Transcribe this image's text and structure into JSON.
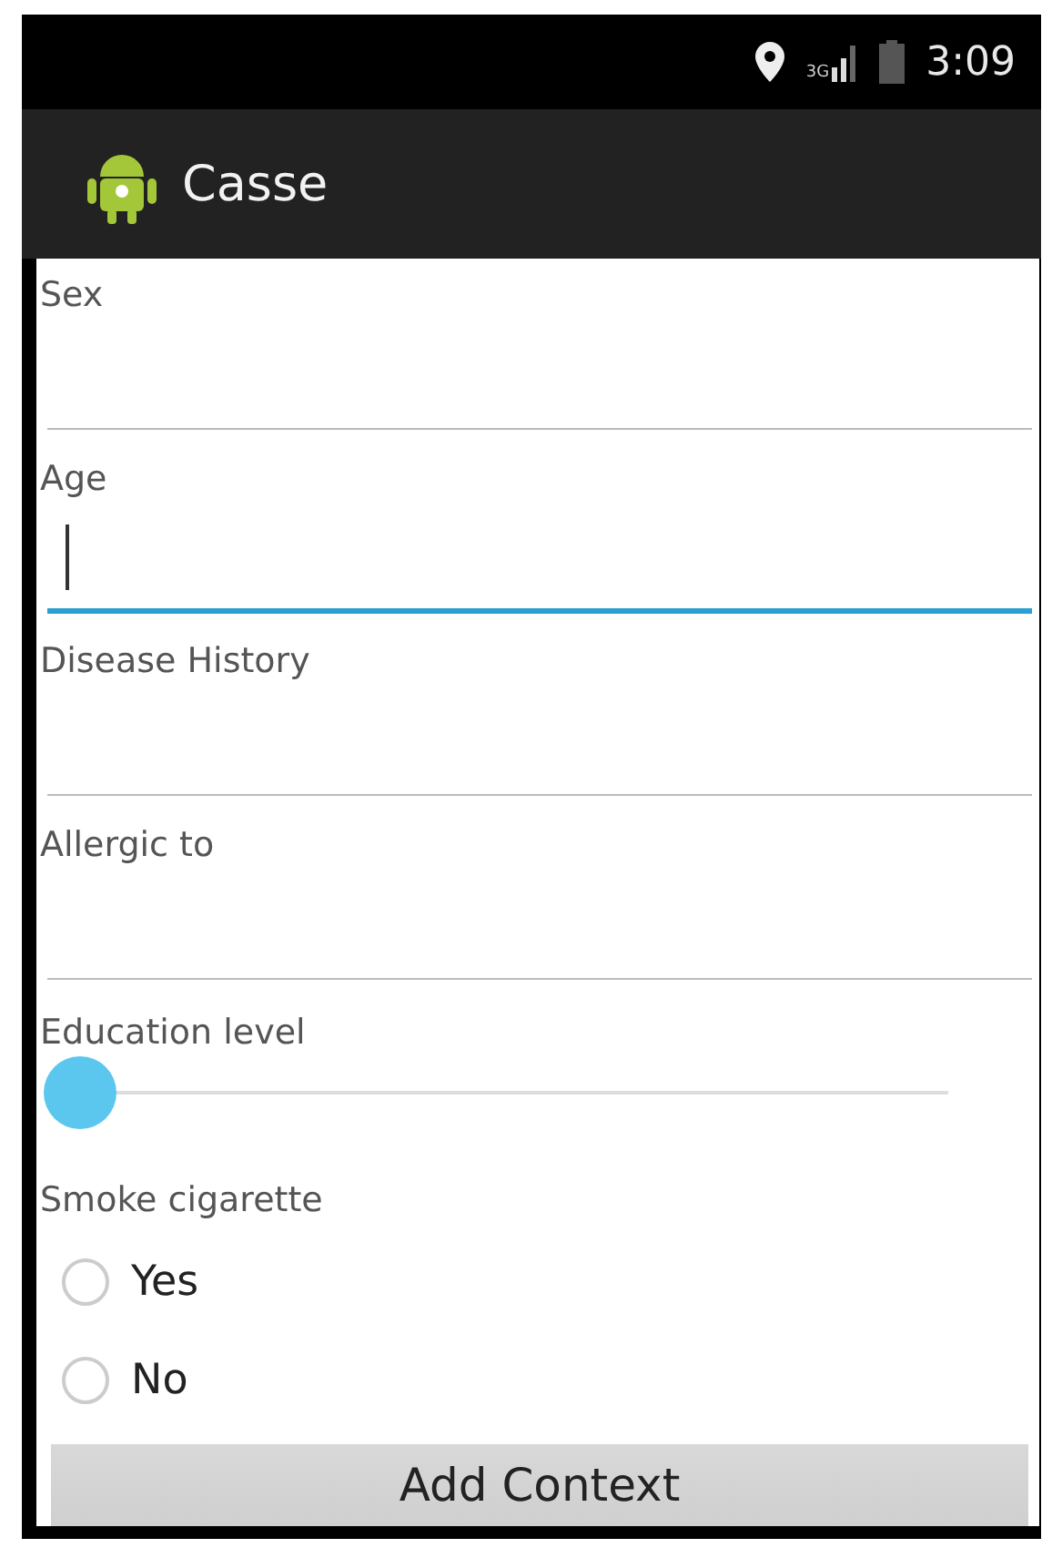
{
  "status_bar": {
    "network": "3G",
    "time": "3:09"
  },
  "action_bar": {
    "title": "Casse"
  },
  "fields": [
    {
      "label": "Sex",
      "focused": false
    },
    {
      "label": "Age",
      "focused": true
    },
    {
      "label": "Disease History",
      "focused": false
    },
    {
      "label": "Allergic to",
      "focused": false
    }
  ],
  "education": {
    "label": "Education level",
    "level": 0
  },
  "smoke": {
    "label": "Smoke cigarette",
    "options": [
      {
        "label": "Yes",
        "selected": false
      },
      {
        "label": "No",
        "selected": false
      }
    ]
  },
  "button": {
    "label": "Add Context"
  }
}
